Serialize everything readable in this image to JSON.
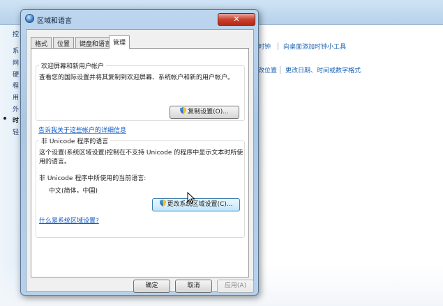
{
  "background": {
    "left_items": [
      "控",
      "系",
      "网",
      "硬",
      "程",
      "用",
      "外",
      "时",
      "轻"
    ],
    "active_left_index": 7,
    "links_row1": [
      "时钟",
      "向桌面添加时钟小工具"
    ],
    "links_row2": [
      "改位置",
      "更改日期、时间或数字格式"
    ]
  },
  "dialog": {
    "title": "区域和语言",
    "close_label": "✕",
    "tabs": [
      "格式",
      "位置",
      "键盘和语言",
      "管理"
    ],
    "active_tab": "管理",
    "welcome_group": {
      "title": "欢迎屏幕和新用户帐户",
      "description": "查看您的国际设置并将其复制到欢迎屏幕、系统帐户和新的用户帐户。",
      "copy_button": "复制设置(O)...",
      "link": "告诉我关于这些帐户的详细信息"
    },
    "unicode_group": {
      "title": "非 Unicode 程序的语言",
      "description_line1": "这个设置(系统区域设置)控制在不支持 Unicode 的程序中显示文本时所使",
      "description_line2": "用的语言。",
      "current_label": "非 Unicode 程序中所使用的当前语言:",
      "current_value": "中文(简体，中国)",
      "change_button": "更改系统区域设置(C)...",
      "link": "什么是系统区域设置?"
    },
    "buttons": {
      "ok": "确定",
      "cancel": "取消",
      "apply": "应用(A)"
    }
  },
  "colors": {
    "link": "#0a5ac8",
    "close": "#c9412c",
    "title_glass": "#bcd6ee"
  }
}
